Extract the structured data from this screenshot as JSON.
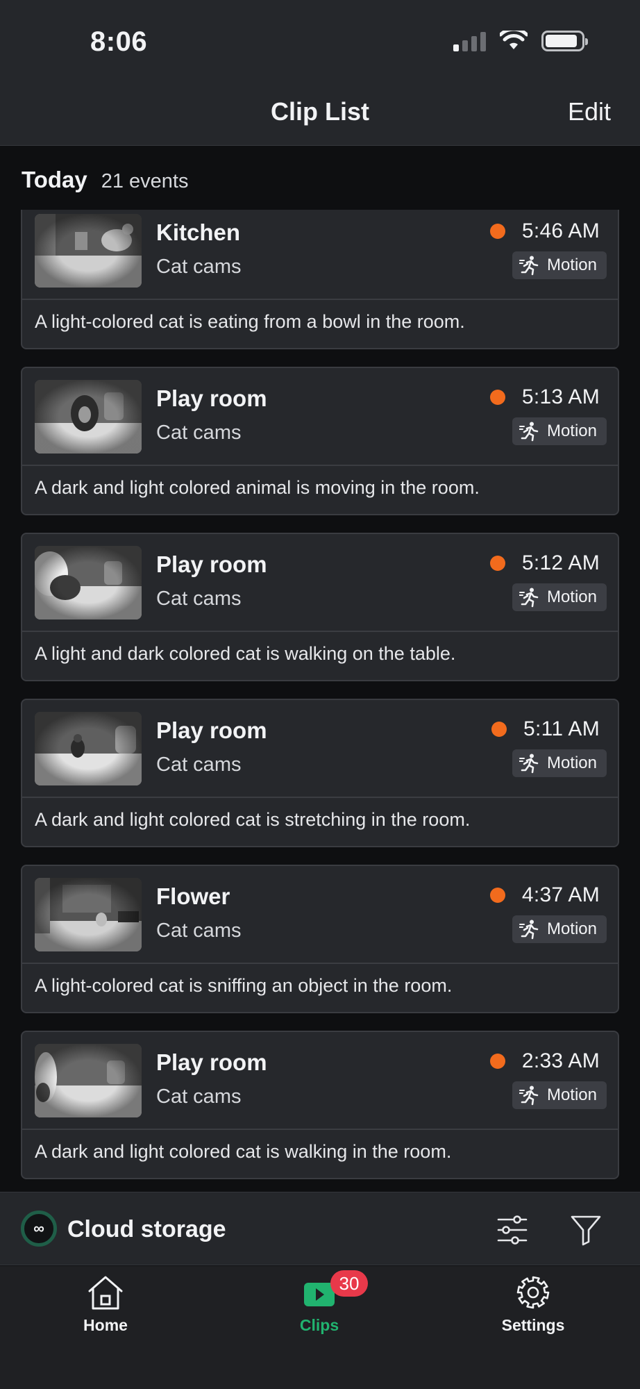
{
  "status_bar": {
    "time": "8:06"
  },
  "header": {
    "title": "Clip List",
    "edit_label": "Edit"
  },
  "section": {
    "title": "Today",
    "count": "21 events"
  },
  "colors": {
    "accent_green": "#21b36f",
    "event_dot": "#f26b1d",
    "badge_red": "#e8394a"
  },
  "clips": [
    {
      "name": "Kitchen",
      "group": "Cat cams",
      "time": "5:46 AM",
      "tag": "Motion",
      "description": "A light-colored cat is eating from a bowl in the room."
    },
    {
      "name": "Play room",
      "group": "Cat cams",
      "time": "5:13 AM",
      "tag": "Motion",
      "description": "A dark and light colored animal is moving in the room."
    },
    {
      "name": "Play room",
      "group": "Cat cams",
      "time": "5:12 AM",
      "tag": "Motion",
      "description": "A light and dark colored cat is walking on the table."
    },
    {
      "name": "Play room",
      "group": "Cat cams",
      "time": "5:11 AM",
      "tag": "Motion",
      "description": "A dark and light colored cat is stretching in the room."
    },
    {
      "name": "Flower",
      "group": "Cat cams",
      "time": "4:37 AM",
      "tag": "Motion",
      "description": "A light-colored cat is sniffing an object in the room."
    },
    {
      "name": "Play room",
      "group": "Cat cams",
      "time": "2:33 AM",
      "tag": "Motion",
      "description": "A dark and light colored cat is walking in the room."
    }
  ],
  "cloud_bar": {
    "label": "Cloud storage",
    "badge_symbol": "∞"
  },
  "tabs": {
    "home_label": "Home",
    "clips_label": "Clips",
    "clips_badge": "30",
    "settings_label": "Settings"
  }
}
